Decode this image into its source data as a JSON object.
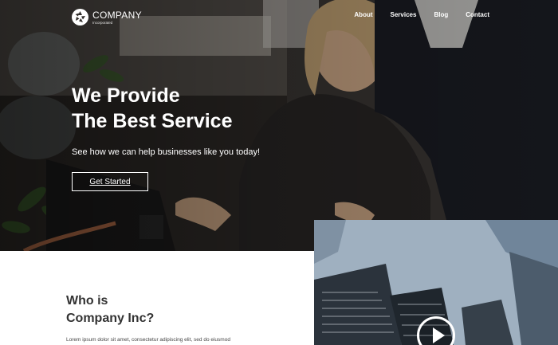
{
  "brand": {
    "name": "COMPANY",
    "tagline": "Incorporated"
  },
  "nav": {
    "items": [
      "About",
      "Services",
      "Blog",
      "Contact"
    ]
  },
  "hero": {
    "title_line1": "We Provide",
    "title_line2": "The Best Service",
    "subtitle": "See how we can help businesses like you today!",
    "cta_label": "Get Started"
  },
  "about": {
    "title_line1": "Who is",
    "title_line2": "Company Inc?",
    "body": "Lorem ipsum dolor sit amet, consectetur adipiscing elit, sed do eiusmod"
  },
  "icons": {
    "logo": "aperture-logo-icon",
    "video": "play-icon"
  },
  "colors": {
    "text_dark": "#333333",
    "white": "#ffffff"
  }
}
